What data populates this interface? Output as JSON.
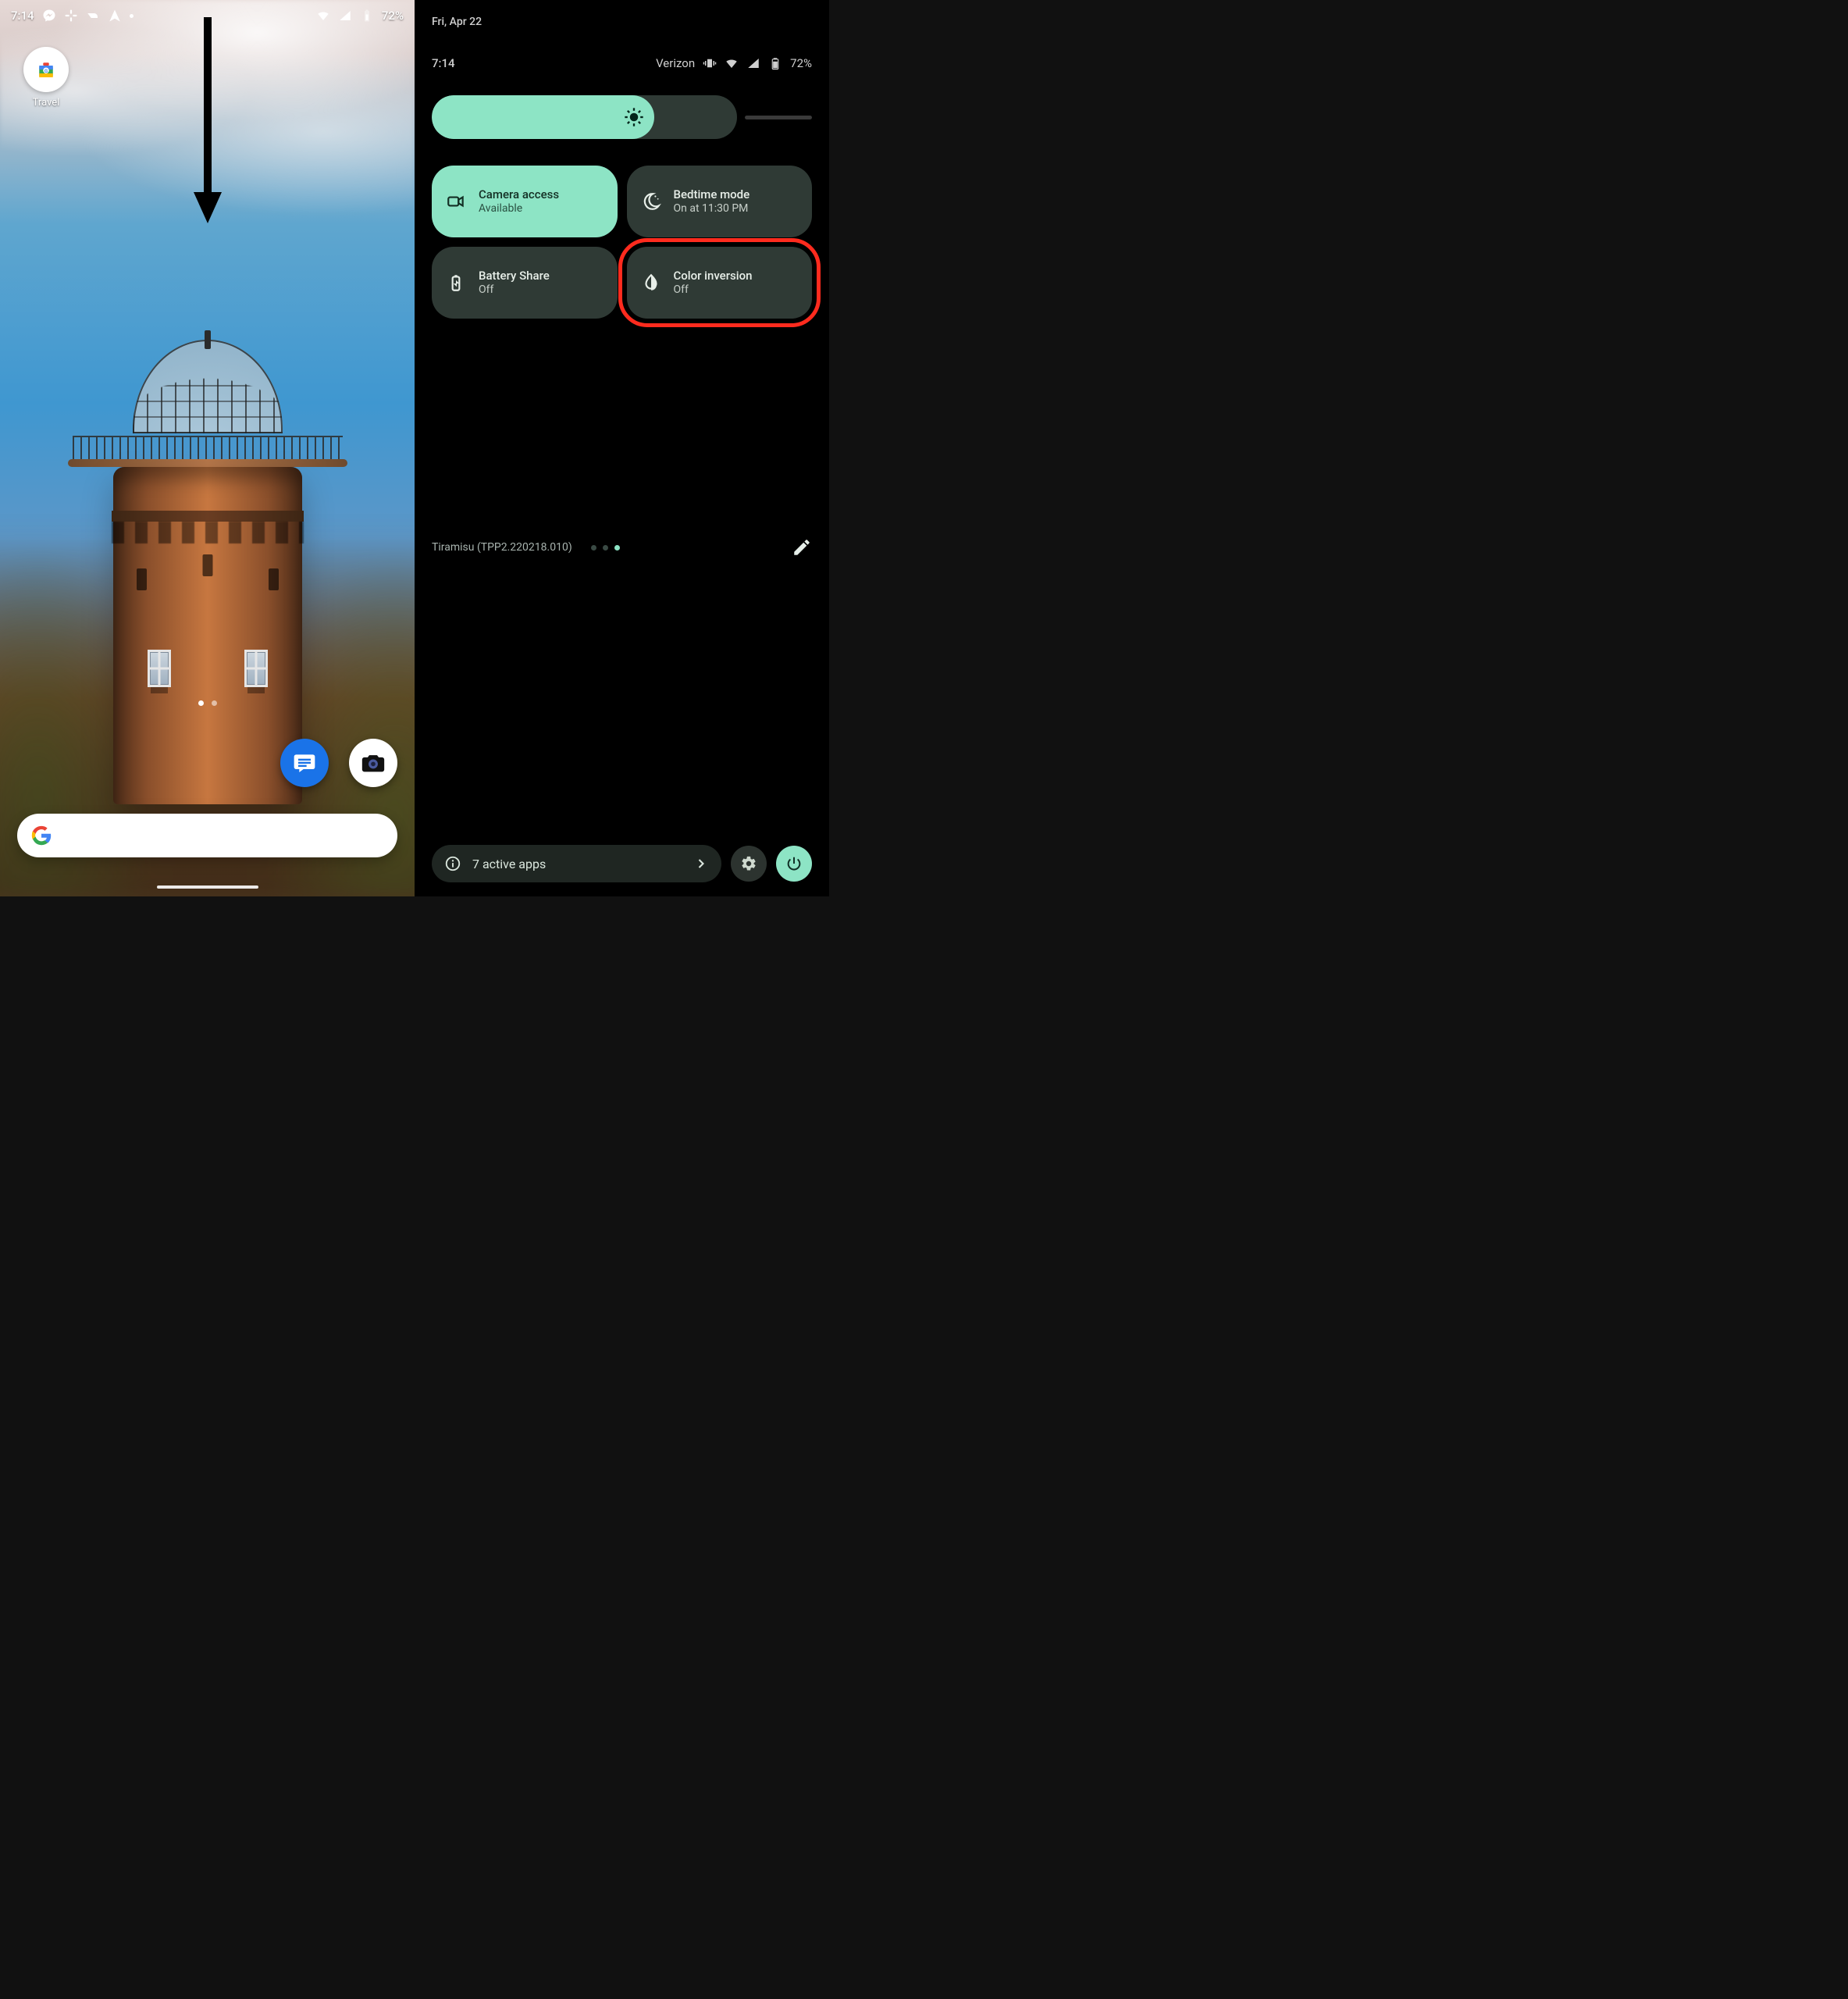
{
  "left": {
    "status": {
      "time": "7:14",
      "battery": "72%"
    },
    "home_app": {
      "label": "Travel"
    }
  },
  "right": {
    "date": "Fri, Apr 22",
    "status": {
      "time": "7:14",
      "carrier": "Verizon",
      "battery": "72%"
    },
    "tiles": [
      {
        "title": "Camera access",
        "subtitle": "Available",
        "active": true,
        "highlight": false,
        "icon": "video-icon"
      },
      {
        "title": "Bedtime mode",
        "subtitle": "On at 11:30 PM",
        "active": false,
        "highlight": false,
        "icon": "bedtime-icon"
      },
      {
        "title": "Battery Share",
        "subtitle": "Off",
        "active": false,
        "highlight": false,
        "icon": "battery-share-icon"
      },
      {
        "title": "Color inversion",
        "subtitle": "Off",
        "active": false,
        "highlight": true,
        "icon": "invert-icon"
      }
    ],
    "build": "Tiramisu (TPP2.220218.010)",
    "footer_active": "7 active apps"
  }
}
